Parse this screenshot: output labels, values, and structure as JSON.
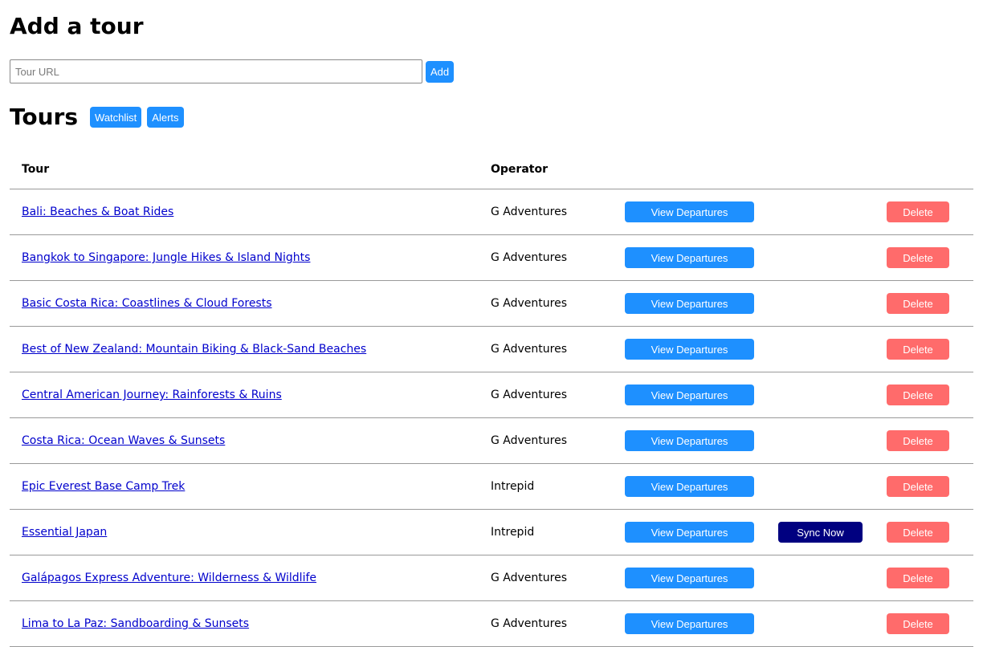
{
  "add_section": {
    "title": "Add a tour",
    "url_placeholder": "Tour URL",
    "url_value": "",
    "add_label": "Add"
  },
  "tours_section": {
    "title": "Tours",
    "watchlist_label": "Watchlist",
    "alerts_label": "Alerts"
  },
  "table": {
    "headers": {
      "tour": "Tour",
      "operator": "Operator"
    },
    "view_label": "View Departures",
    "sync_label": "Sync Now",
    "delete_label": "Delete",
    "rows": [
      {
        "tour": "Bali: Beaches & Boat Rides",
        "operator": "G Adventures",
        "sync": false
      },
      {
        "tour": "Bangkok to Singapore: Jungle Hikes & Island Nights",
        "operator": "G Adventures",
        "sync": false
      },
      {
        "tour": "Basic Costa Rica: Coastlines & Cloud Forests",
        "operator": "G Adventures",
        "sync": false
      },
      {
        "tour": "Best of New Zealand: Mountain Biking & Black-Sand Beaches",
        "operator": "G Adventures",
        "sync": false
      },
      {
        "tour": "Central American Journey: Rainforests & Ruins",
        "operator": "G Adventures",
        "sync": false
      },
      {
        "tour": "Costa Rica: Ocean Waves & Sunsets",
        "operator": "G Adventures",
        "sync": false
      },
      {
        "tour": "Epic Everest Base Camp Trek",
        "operator": "Intrepid",
        "sync": false
      },
      {
        "tour": "Essential Japan",
        "operator": "Intrepid",
        "sync": true
      },
      {
        "tour": "Galápagos Express Adventure: Wilderness & Wildlife",
        "operator": "G Adventures",
        "sync": false
      },
      {
        "tour": "Lima to La Paz: Sandboarding & Sunsets",
        "operator": "G Adventures",
        "sync": false
      }
    ]
  },
  "colors": {
    "primary": "#1e90ff",
    "sync": "#000080",
    "delete": "#ff6b6b",
    "link": "#0000cc"
  }
}
